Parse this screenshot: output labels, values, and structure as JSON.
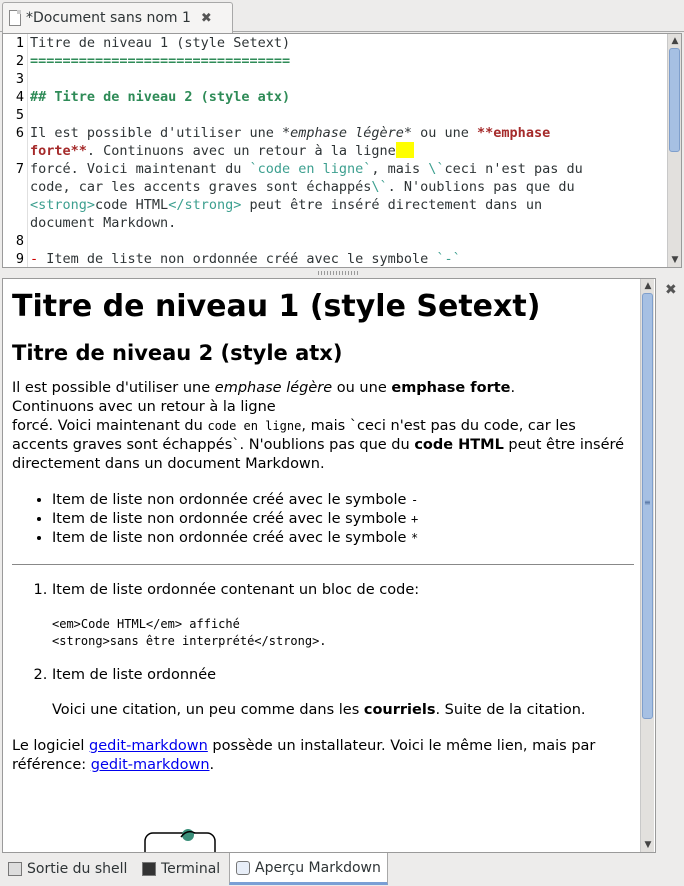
{
  "document_tab": {
    "title": "*Document sans nom 1",
    "close_label": "✖"
  },
  "editor": {
    "line_numbers": [
      "1",
      "2",
      "3",
      "4",
      "5",
      "6",
      "7",
      "8",
      "9"
    ],
    "line1": "Titre de niveau 1 (style Setext)",
    "line2": "================================",
    "line4": "## Titre de niveau 2 (style atx)",
    "line6a_1": "Il est possible d'utiliser une ",
    "line6a_em": "*emphase légère*",
    "line6a_2": " ou une ",
    "line6a_strong": "**emphase",
    "line6b_strong": "forte**",
    "line6b_2": ". Continuons avec un retour à la ligne",
    "line7a_1": "forcé. Voici maintenant du ",
    "line7a_code": "`code en ligne`",
    "line7a_2": ", mais ",
    "line7a_esc": "\\`",
    "line7a_3": "ceci n'est pas du",
    "line7b_1": "code, car les accents graves sont échappés",
    "line7b_esc": "\\`",
    "line7b_2": ". N'oublions pas que du",
    "line7c_tag1": "<strong>",
    "line7c_1": "code HTML",
    "line7c_tag2": "</strong>",
    "line7c_2": " peut être inséré directement dans un",
    "line7d": "document Markdown.",
    "line9_dash": "-",
    "line9_1": " Item de liste non ordonnée créé avec le symbole ",
    "line9_code": "`-`"
  },
  "preview": {
    "h1": "Titre de niveau 1 (style Setext)",
    "h2": "Titre de niveau 2 (style atx)",
    "p1_1": "Il est possible d'utiliser une ",
    "p1_em": "emphase légère",
    "p1_2": " ou une ",
    "p1_strong": "emphase forte",
    "p1_3": ".",
    "p1_line2": "Continuons avec un retour à la ligne",
    "p1_line3_1": "forcé. Voici maintenant du ",
    "p1_code": "code en ligne",
    "p1_line3_2": ", mais `ceci n'est pas du code, car les accents graves sont échappés`. N'oublions pas que du ",
    "p1_strong2": "code HTML",
    "p1_line3_3": " peut être inséré directement dans un document Markdown.",
    "ul": [
      {
        "text": "Item de liste non ordonnée créé avec le symbole ",
        "sym": "-"
      },
      {
        "text": "Item de liste non ordonnée créé avec le symbole ",
        "sym": "+"
      },
      {
        "text": "Item de liste non ordonnée créé avec le symbole ",
        "sym": "*"
      }
    ],
    "ol1": "Item de liste ordonnée contenant un bloc de code:",
    "pre_line1": "<em>Code HTML</em> affiché",
    "pre_line2": "<strong>sans être interprété</strong>.",
    "ol2": "Item de liste ordonnée",
    "quote_1": "Voici une citation, un peu comme dans les ",
    "quote_strong": "courriels",
    "quote_2": ". Suite de la citation.",
    "p2_1": "Le logiciel ",
    "p2_link1": "gedit-markdown",
    "p2_2": " possède un installateur. Voici le même lien, mais par référence: ",
    "p2_link2": "gedit-markdown",
    "p2_3": "."
  },
  "bottom_tabs": [
    {
      "label": "Sortie du shell"
    },
    {
      "label": "Terminal"
    },
    {
      "label": "Aperçu Markdown"
    }
  ],
  "colors": {
    "heading_green": "#2e8b57",
    "code_teal": "#3c9f8f",
    "strong_red": "#a52a2a",
    "caret_yellow": "#ffff00",
    "scroll_thumb": "#a6c0e3"
  }
}
